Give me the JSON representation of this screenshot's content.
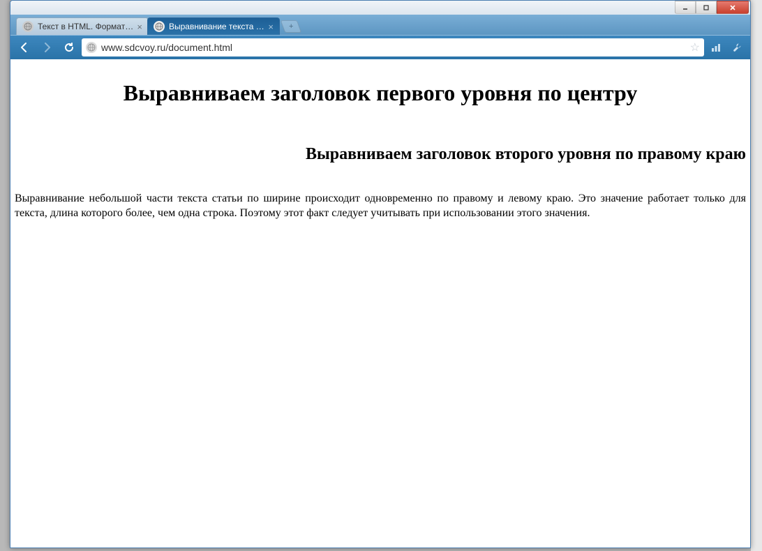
{
  "window": {
    "controls": {
      "minimize": "–",
      "maximize": "❐",
      "close": "✕"
    }
  },
  "tabs": [
    {
      "title": "Текст в HTML. Форматиро",
      "active": false
    },
    {
      "title": "Выравнивание текста в до",
      "active": true
    }
  ],
  "toolbar": {
    "url": "www.sdcvoy.ru/document.html"
  },
  "page": {
    "h1": "Выравниваем заголовок первого уровня по центру",
    "h2": "Выравниваем заголовок второго уровня по правому краю",
    "paragraph": "Выравнивание небольшой части текста статьи по ширине происходит одновременно по правому и левому краю. Это значение работает только для текста, длина которого более, чем одна строка. Поэтому этот факт следует учитывать при  использовании этого значения."
  }
}
